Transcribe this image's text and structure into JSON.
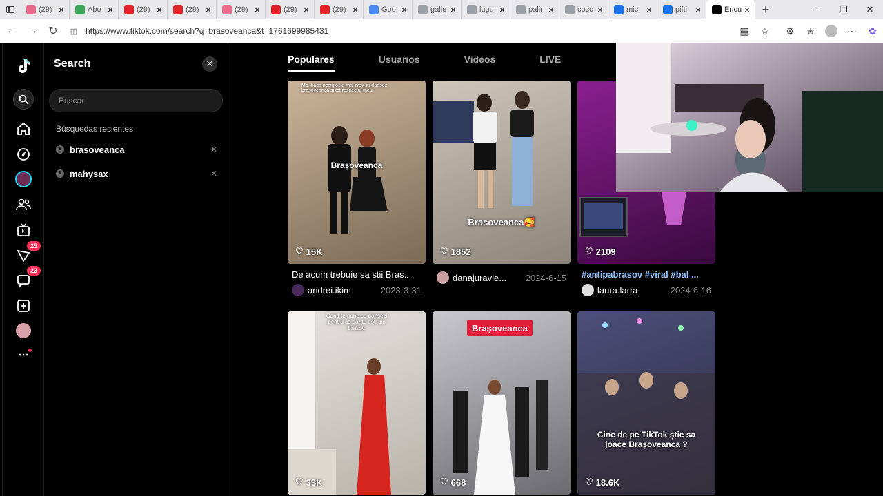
{
  "browser": {
    "tabs": [
      {
        "label": "(29)",
        "fav": "#e96a8a"
      },
      {
        "label": "Abo",
        "fav": "#3aa657"
      },
      {
        "label": "(29)",
        "fav": "#e3242b"
      },
      {
        "label": "(29)",
        "fav": "#e3242b"
      },
      {
        "label": "(29)",
        "fav": "#e96a8a"
      },
      {
        "label": "(29)",
        "fav": "#e3242b"
      },
      {
        "label": "(29)",
        "fav": "#e3242b"
      },
      {
        "label": "Goo",
        "fav": "#4a8af4"
      },
      {
        "label": "galle",
        "fav": "#9aa0a6"
      },
      {
        "label": "lugu",
        "fav": "#9aa0a6"
      },
      {
        "label": "palir",
        "fav": "#9aa0a6"
      },
      {
        "label": "coco",
        "fav": "#9aa0a6"
      },
      {
        "label": "mici",
        "fav": "#1a73e8"
      },
      {
        "label": "pifti",
        "fav": "#1a73e8"
      },
      {
        "label": "Encu",
        "fav": "#000000",
        "active": true
      }
    ],
    "url": "https://www.tiktok.com/search?q=brasoveanca&t=1761699985431"
  },
  "rail": {
    "badge_inbox": "25",
    "badge_messages": "23"
  },
  "search_panel": {
    "title": "Search",
    "placeholder": "Buscar",
    "recent_label": "Búsquedas recientes",
    "recent": [
      "brasoveanca",
      "mahysax"
    ]
  },
  "result_tabs": [
    "Populares",
    "Usuarios",
    "Videos",
    "LIVE"
  ],
  "videos": [
    {
      "likes": "15K",
      "overlay": "Brașoveanca",
      "top_text": "Mo, baca ncajujo sa mai-ivey sa dansez brasoveanca si tot respectul meu",
      "caption": "De acum trebuie sa stii Bras...",
      "author": "andrei.ikim",
      "date": "2023-3-31",
      "colors": [
        "#c9b49b",
        "#7c6a55"
      ]
    },
    {
      "likes": "1852",
      "overlay": "Brasoveanca🥰",
      "caption": "",
      "author": "danajuravle...",
      "date": "2024-6-15",
      "colors": [
        "#cdc6bb",
        "#8e857a"
      ]
    },
    {
      "likes": "2109",
      "overlay": "",
      "caption": "#antipabrasov #viral #bal ...",
      "author": "laura.larra",
      "date": "2024-6-16",
      "colors": [
        "#8a1f8f",
        "#3a0a3f"
      ]
    },
    {
      "likes": "33K",
      "overlay": "Cand te pune sa dansezi pentru ca dar tu esti din Brasov.",
      "caption": "",
      "author": "",
      "date": "",
      "colors": [
        "#e4e2de",
        "#b9b3aa"
      ]
    },
    {
      "likes": "668",
      "overlay": "Brașoveanca",
      "caption": "",
      "author": "",
      "date": "",
      "colors": [
        "#c8c8cc",
        "#6b6b70"
      ]
    },
    {
      "likes": "18.6K",
      "overlay": "Cine de pe TikTok știe sa joace Brașoveanca ?",
      "caption": "",
      "author": "",
      "date": "",
      "colors": [
        "#4c4f7a",
        "#2b2a3a"
      ]
    }
  ]
}
